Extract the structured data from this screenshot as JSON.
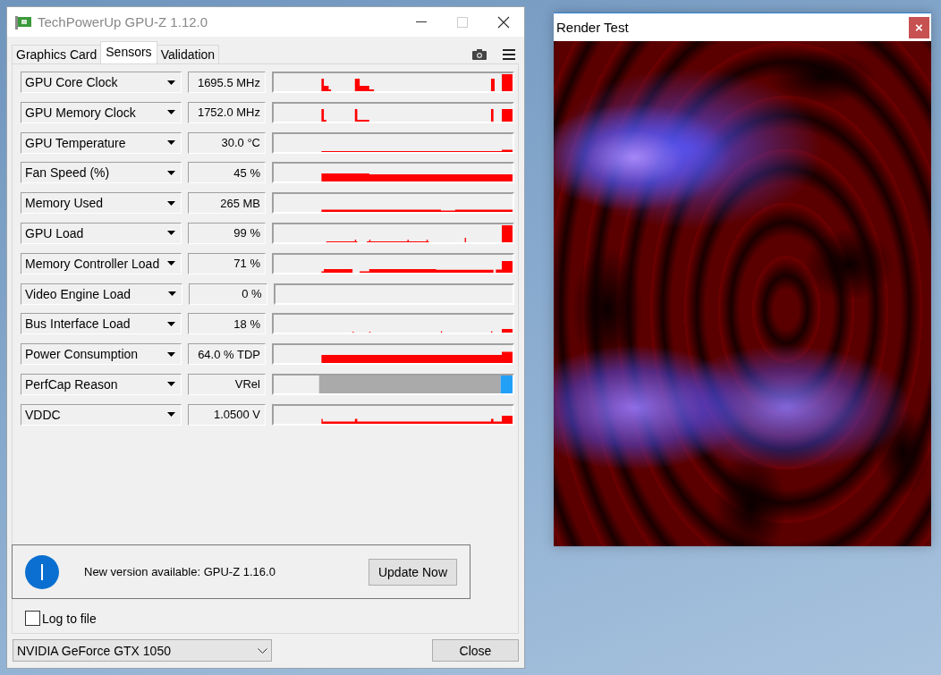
{
  "window": {
    "title": "TechPowerUp GPU-Z 1.12.0"
  },
  "tabs": [
    {
      "label": "Graphics Card",
      "selected": false
    },
    {
      "label": "Sensors",
      "selected": true
    },
    {
      "label": "Validation",
      "selected": false
    }
  ],
  "sensors": [
    {
      "name": "GPU Core Clock",
      "value": "1695.5 MHz",
      "kind": "graph"
    },
    {
      "name": "GPU Memory Clock",
      "value": "1752.0 MHz",
      "kind": "graph"
    },
    {
      "name": "GPU Temperature",
      "value": "30.0 °C",
      "kind": "graph"
    },
    {
      "name": "Fan Speed (%)",
      "value": "45 %",
      "kind": "graph"
    },
    {
      "name": "Memory Used",
      "value": "265 MB",
      "kind": "graph"
    },
    {
      "name": "GPU Load",
      "value": "99 %",
      "kind": "graph"
    },
    {
      "name": "Memory Controller Load",
      "value": "71 %",
      "kind": "graph"
    },
    {
      "name": "Video Engine Load",
      "value": "0 %",
      "kind": "graph"
    },
    {
      "name": "Bus Interface Load",
      "value": "18 %",
      "kind": "graph"
    },
    {
      "name": "Power Consumption",
      "value": "64.0 % TDP",
      "kind": "graph"
    },
    {
      "name": "PerfCap Reason",
      "value": "VRel",
      "kind": "perfcap"
    },
    {
      "name": "VDDC",
      "value": "1.0500 V",
      "kind": "graph"
    }
  ],
  "notification": {
    "message": "New version available: GPU-Z 1.16.0",
    "button": "Update Now"
  },
  "log_to_file": {
    "label": "Log to file",
    "checked": false
  },
  "gpu_select": {
    "value": "NVIDIA GeForce GTX 1050"
  },
  "close_button": "Close",
  "render_window": {
    "title": "Render Test",
    "close": "×"
  }
}
